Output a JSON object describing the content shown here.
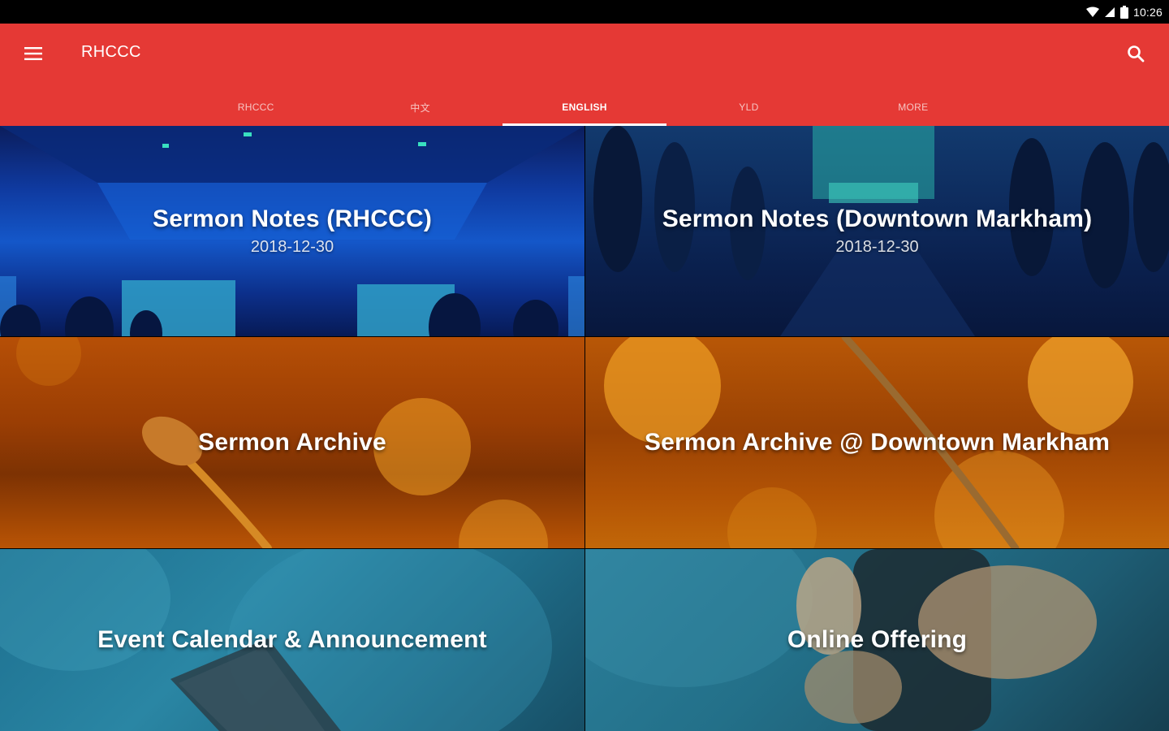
{
  "status_bar": {
    "time": "10:26"
  },
  "app_bar": {
    "title": "RHCCC"
  },
  "tabs": [
    {
      "label": "RHCCC",
      "active": false
    },
    {
      "label": "中文",
      "active": false
    },
    {
      "label": "ENGLISH",
      "active": true
    },
    {
      "label": "YLD",
      "active": false
    },
    {
      "label": "MORE",
      "active": false
    }
  ],
  "tiles": [
    {
      "title": "Sermon Notes (RHCCC)",
      "date": "2018-12-30"
    },
    {
      "title": "Sermon Notes (Downtown Markham)",
      "date": "2018-12-30"
    },
    {
      "title": "Sermon Archive"
    },
    {
      "title": "Sermon Archive @ Downtown Markham"
    },
    {
      "title": "Event Calendar & Announcement"
    },
    {
      "title": "Online Offering"
    }
  ],
  "colors": {
    "app_bar": "#e53935",
    "status_bar": "#000000"
  }
}
